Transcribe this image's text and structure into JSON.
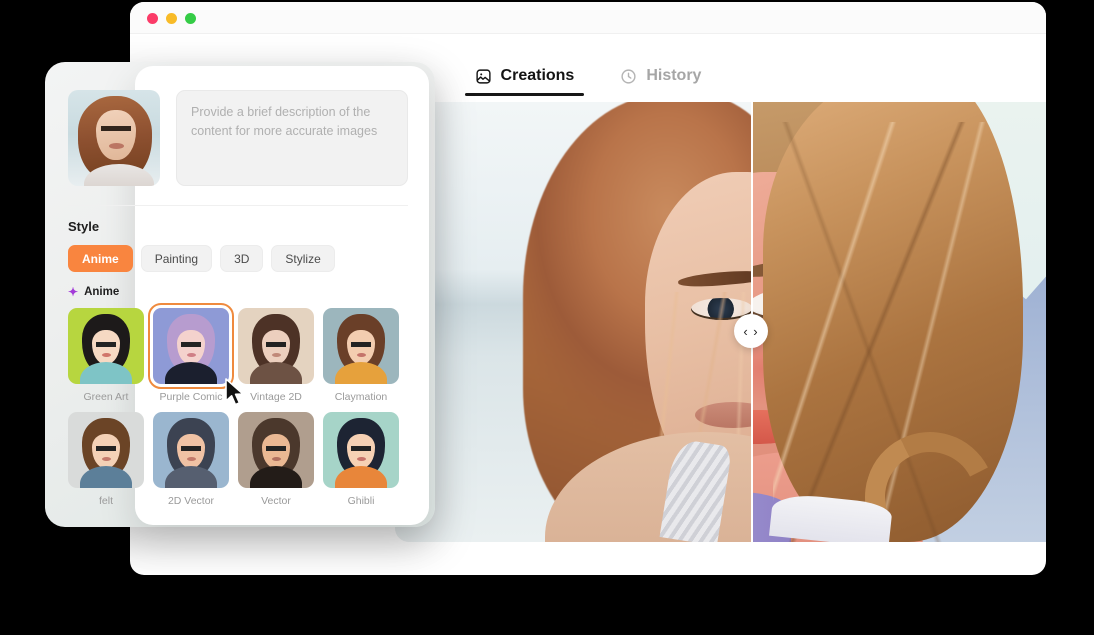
{
  "window": {
    "traffic_lights": [
      {
        "name": "close",
        "color": "#fb3b68"
      },
      {
        "name": "minimize",
        "color": "#f8bb28"
      },
      {
        "name": "maximize",
        "color": "#35cc46"
      }
    ]
  },
  "tabs": [
    {
      "label": "Creations",
      "icon": "image-icon",
      "active": true
    },
    {
      "label": "History",
      "icon": "clock-icon",
      "active": false
    }
  ],
  "prompt": {
    "placeholder": "Provide a brief description of the content for more accurate images",
    "value": "",
    "thumbnail_alt": "uploaded-portrait-photo"
  },
  "style": {
    "title": "Style",
    "accent_color": "#f9853f",
    "sparkle_color": "#a23bd8",
    "categories": [
      {
        "label": "Anime",
        "active": true
      },
      {
        "label": "Painting",
        "active": false
      },
      {
        "label": "3D",
        "active": false
      },
      {
        "label": "Stylize",
        "active": false
      }
    ],
    "sub_label": "Anime",
    "presets": [
      {
        "label": "Green Art",
        "selected": false,
        "bg": "#b7d63f",
        "hair": "#1d1a1a",
        "skin": "#f6d9c3",
        "body": "#7ec4c6",
        "mouth": "#d0756a"
      },
      {
        "label": "Purple Comic",
        "selected": true,
        "bg": "#8e9ad6",
        "hair": "#b79ccf",
        "skin": "#f4d2cd",
        "body": "#1b1f2e",
        "mouth": "#cf7f86"
      },
      {
        "label": "Vintage 2D",
        "selected": false,
        "bg": "#e4d3c0",
        "hair": "#4d3226",
        "skin": "#eccfbe",
        "body": "#6d5244",
        "mouth": "#c08878"
      },
      {
        "label": "Claymation",
        "selected": false,
        "bg": "#9cb6bd",
        "hair": "#6a3f28",
        "skin": "#f3cdb0",
        "body": "#e6a13c",
        "mouth": "#c4736a"
      },
      {
        "label": "felt",
        "selected": false,
        "bg": "#d9dbda",
        "hair": "#6b4426",
        "skin": "#f4d1b6",
        "body": "#5c7f99",
        "mouth": "#c47a6c"
      },
      {
        "label": "2D Vector",
        "selected": false,
        "bg": "#9ab6cf",
        "hair": "#3c4352",
        "skin": "#f0c2a4",
        "body": "#565f70",
        "mouth": "#c37a6a"
      },
      {
        "label": "Vector",
        "selected": false,
        "bg": "#b09e8e",
        "hair": "#4b382c",
        "skin": "#eab893",
        "body": "#231c18",
        "mouth": "#b0705f"
      },
      {
        "label": "Ghibli",
        "selected": false,
        "bg": "#a6d4c8",
        "hair": "#1d2433",
        "skin": "#f6d1b4",
        "body": "#e8863a",
        "mouth": "#c8736a"
      }
    ]
  },
  "comparison": {
    "before_alt": "original-photo-half",
    "after_alt": "ai-illustrated-half",
    "handle_icon": "left-right-chevrons",
    "handle_glyph": "‹ ›"
  }
}
